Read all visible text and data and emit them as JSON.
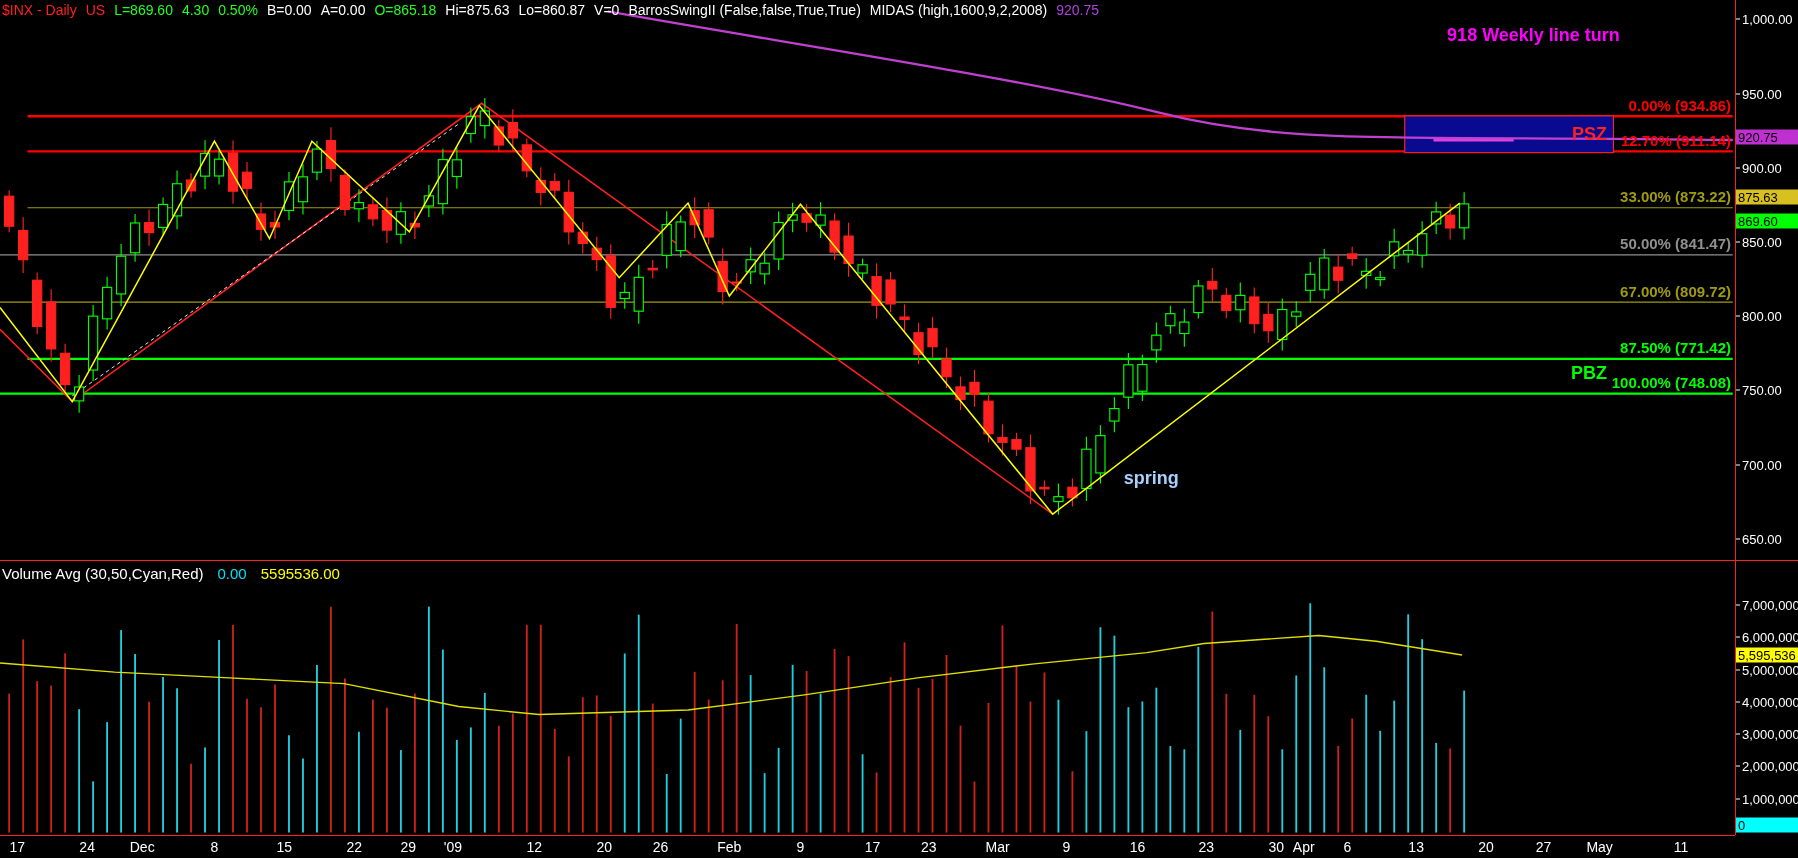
{
  "header": [
    {
      "text": "$INX - Daily",
      "color": "#ff2020"
    },
    {
      "text": "US",
      "color": "#ff2020"
    },
    {
      "text": "L=869.60",
      "color": "#20ff20"
    },
    {
      "text": "4.30",
      "color": "#20ff20"
    },
    {
      "text": "0.50%",
      "color": "#20ff20"
    },
    {
      "text": "B=0.00",
      "color": "#ffffff"
    },
    {
      "text": "A=0.00",
      "color": "#ffffff"
    },
    {
      "text": "O=865.18",
      "color": "#20ff20"
    },
    {
      "text": "Hi=875.63",
      "color": "#ffffff"
    },
    {
      "text": "Lo=860.87",
      "color": "#ffffff"
    },
    {
      "text": "V=0",
      "color": "#ffffff"
    },
    {
      "text": "BarrosSwingII (False,false,True,True)",
      "color": "#ffffff"
    },
    {
      "text": "MIDAS (high,1600,9,2,2008)",
      "color": "#ffffff"
    },
    {
      "text": "920.75",
      "color": "#b040e0"
    }
  ],
  "annotation_title": "918 Weekly line turn",
  "zones": [
    {
      "label": "PSZ",
      "color": "#ff2020"
    },
    {
      "label": "PBZ",
      "color": "#00ff00"
    }
  ],
  "spring_label": "spring",
  "fib_levels": [
    {
      "label": "0.00% (934.86)",
      "color": "#ff0000"
    },
    {
      "label": "12.70% (911.14)",
      "color": "#ff0000"
    },
    {
      "label": "33.00% (873.22)",
      "color": "#a09a10"
    },
    {
      "label": "50.00% (841.47)",
      "color": "#909090"
    },
    {
      "label": "67.00% (809.72)",
      "color": "#a09a10"
    },
    {
      "label": "87.50% (771.42)",
      "color": "#00ff00"
    },
    {
      "label": "100.00% (748.08)",
      "color": "#00ff00"
    }
  ],
  "price_axis": {
    "ticks": [
      "1,000.00",
      "950.00",
      "900.00",
      "850.00",
      "800.00",
      "750.00",
      "700.00",
      "650.00"
    ],
    "badges": [
      {
        "text": "920.75",
        "color": "#c030d0"
      },
      {
        "text": "875.63",
        "color": "#d8c020"
      },
      {
        "text": "869.60",
        "color": "#00ff00"
      }
    ]
  },
  "volume_panel": {
    "title": "Volume Avg (30,50,Cyan,Red)",
    "values": [
      {
        "text": "0.00",
        "color": "#00e0ff"
      },
      {
        "text": "5595536.00",
        "color": "#ffff00"
      }
    ],
    "ticks": [
      "7,000,000",
      "6,000,000",
      "5,000,000",
      "4,000,000",
      "3,000,000",
      "2,000,000",
      "1,000,000"
    ],
    "badges": [
      {
        "text": "5,595,536",
        "color": "#ffff00"
      },
      {
        "text": "0",
        "color": "#00ffff"
      }
    ]
  },
  "x_axis": {
    "labels": [
      "17",
      "24",
      "Dec",
      "8",
      "15",
      "22",
      "29",
      "'09",
      "12",
      "20",
      "26",
      "Feb",
      "9",
      "17",
      "23",
      "Mar",
      "9",
      "16",
      "23",
      "30",
      "Apr",
      "6",
      "13",
      "20",
      "27",
      "May",
      "11"
    ]
  }
}
